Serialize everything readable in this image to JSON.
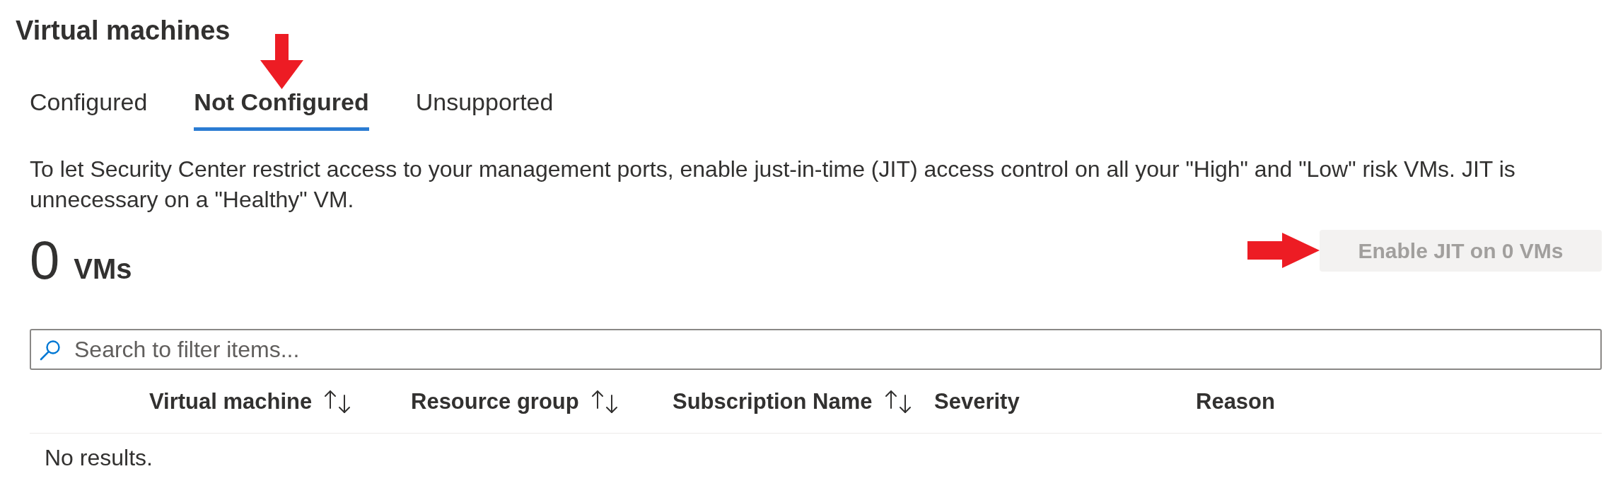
{
  "title": "Virtual machines",
  "tabs": [
    {
      "label": "Configured",
      "selected": false,
      "callout": false
    },
    {
      "label": "Not Configured",
      "selected": true,
      "callout": true
    },
    {
      "label": "Unsupported",
      "selected": false,
      "callout": false
    }
  ],
  "description": "To let Security Center restrict access to your management ports, enable just-in-time (JIT) access control on all your \"High\" and \"Low\" risk VMs. JIT is unnecessary on a \"Healthy\" VM.",
  "count": {
    "value": "0",
    "unit": "VMs"
  },
  "action_button": {
    "label": "Enable JIT on 0 VMs",
    "disabled": true,
    "callout": true
  },
  "search": {
    "placeholder": "Search to filter items..."
  },
  "table": {
    "columns": [
      {
        "label": "Virtual machine",
        "sortable": true
      },
      {
        "label": "Resource group",
        "sortable": true
      },
      {
        "label": "Subscription Name",
        "sortable": true
      },
      {
        "label": "Severity",
        "sortable": false
      },
      {
        "label": "Reason",
        "sortable": false
      }
    ],
    "empty_text": "No results."
  }
}
